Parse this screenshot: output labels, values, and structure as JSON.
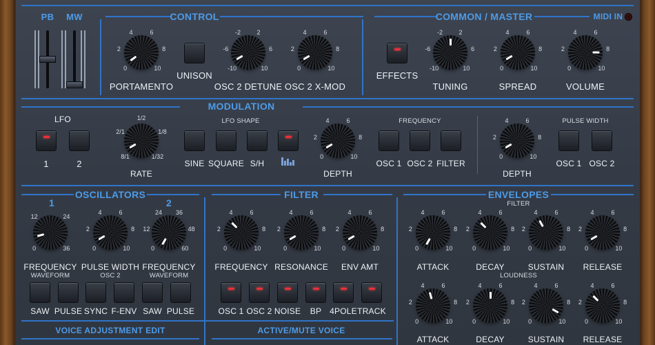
{
  "sections": {
    "pb": "PB",
    "mw": "MW",
    "control": "CONTROL",
    "common_master": "COMMON / MASTER",
    "midi_in": "MIDI IN",
    "modulation": "MODULATION",
    "oscillators": "OSCILLATORS",
    "filter": "FILTER",
    "envelopes": "ENVELOPES",
    "voice_adjust": "VOICE ADJUSTMENT EDIT",
    "active_mute": "ACTIVE/MUTE VOICE"
  },
  "control": {
    "portamento": "PORTAMENTO",
    "unison": "UNISON",
    "osc2_detune": "OSC 2 DETUNE",
    "osc2_xmod": "OSC 2 X-MOD",
    "effects": "EFFECTS",
    "tuning": "TUNING",
    "spread": "SPREAD",
    "volume": "VOLUME"
  },
  "modulation": {
    "lfo": "LFO",
    "lfo1": "1",
    "lfo2": "2",
    "rate": "RATE",
    "lfo_shape": "LFO SHAPE",
    "sine": "SINE",
    "square": "SQUARE",
    "sh": "S/H",
    "depth": "DEPTH",
    "frequency": "FREQUENCY",
    "osc1": "OSC 1",
    "osc2": "OSC 2",
    "filter": "FILTER",
    "pulse_width": "PULSE WIDTH",
    "depth2": "DEPTH",
    "pw_osc1": "OSC 1",
    "pw_osc2": "OSC 2"
  },
  "oscillators": {
    "num1": "1",
    "num2": "2",
    "freq1": "FREQUENCY",
    "pulse_width": "PULSE WIDTH",
    "freq2": "FREQUENCY",
    "waveform1": "WAVEFORM",
    "osc2": "OSC 2",
    "waveform2": "WAVEFORM",
    "saw1": "SAW",
    "pulse1": "PULSE",
    "sync": "SYNC",
    "fenv": "F-ENV",
    "saw2": "SAW",
    "pulse2": "PULSE"
  },
  "filter": {
    "frequency": "FREQUENCY",
    "resonance": "RESONANCE",
    "env_amt": "ENV AMT",
    "osc1": "OSC 1",
    "osc2": "OSC 2",
    "noise": "NOISE",
    "bp": "BP",
    "fourpole": "4POLE",
    "track": "TRACK"
  },
  "envelopes": {
    "filter_sub": "FILTER",
    "loudness_sub": "LOUDNESS",
    "f_attack": "ATTACK",
    "f_decay": "DECAY",
    "f_sustain": "SUSTAIN",
    "f_release": "RELEASE",
    "l_attack": "ATTACK",
    "l_decay": "DECAY",
    "l_sustain": "SUSTAIN",
    "l_release": "RELEASE"
  },
  "ticks": {
    "t0_10": [
      "0",
      "2",
      "4",
      "6",
      "8",
      "10"
    ],
    "t_detune": [
      "-10",
      "-6",
      "-2",
      "2",
      "6",
      "10"
    ],
    "t_rate": [
      "8/1",
      "2/1",
      "1/2",
      "1/8",
      "1/32"
    ],
    "t_freq1": [
      "0",
      "12",
      "24",
      "36"
    ],
    "t_freq2": [
      "0",
      "12",
      "24",
      "36",
      "48",
      "60"
    ]
  },
  "knob_values": {
    "portamento": 0.08,
    "osc2_detune": 0.1,
    "osc2_xmod": 0.1,
    "tuning": 0.5,
    "spread": 0.1,
    "volume": 0.8,
    "rate": 0.1,
    "lfo_depth": 0.1,
    "pw_depth": 0.1,
    "osc1_freq": 0.15,
    "pulse_width": 0.1,
    "osc2_freq": 0.0,
    "flt_freq": 0.35,
    "flt_res": 0.1,
    "env_amt": 0.1,
    "f_attack": 0.0,
    "f_decay": 0.35,
    "f_sustain": 0.4,
    "f_release": 0.1,
    "l_attack": 0.45,
    "l_decay": 0.5,
    "l_sustain": 0.9,
    "l_release": 0.35
  },
  "leds": {
    "unison": false,
    "effects": true,
    "lfo1": true,
    "lfo2": false,
    "sine": false,
    "square": false,
    "sh": false,
    "random": true,
    "freq_osc1": false,
    "freq_osc2": false,
    "freq_filter": false,
    "pw_osc1": false,
    "pw_osc2": false,
    "saw1": false,
    "pulse1": false,
    "sync": false,
    "fenv": false,
    "saw2": false,
    "pulse2": false,
    "f_osc1": true,
    "f_osc2": true,
    "noise": true,
    "bp": true,
    "fourpole": true,
    "track": true
  },
  "faders": {
    "pb": 0.5,
    "mw": 0.0
  }
}
